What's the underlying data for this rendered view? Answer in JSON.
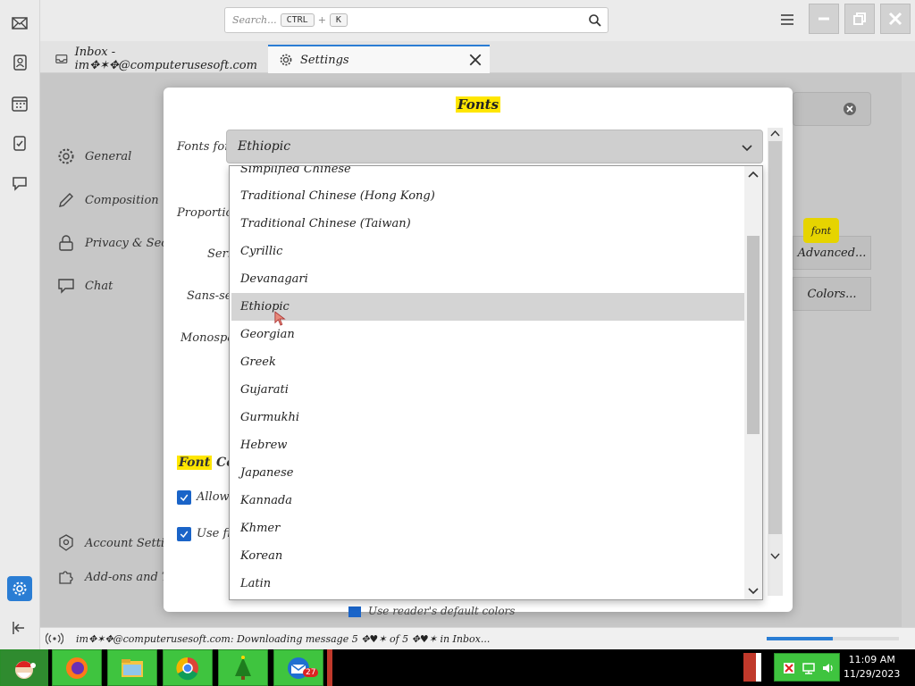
{
  "search": {
    "placeholder": "Search...",
    "shortcut_key1": "CTRL",
    "shortcut_sep": "+",
    "shortcut_key2": "K"
  },
  "tabs": [
    {
      "label": "Inbox - im✥✶✥@computerusesoft.com"
    },
    {
      "label": "Settings"
    }
  ],
  "settings_nav": [
    {
      "label": "General"
    },
    {
      "label": "Composition"
    },
    {
      "label": "Privacy & Secu"
    },
    {
      "label": "Chat"
    }
  ],
  "settings_bottom_nav": [
    {
      "label": "Account Settings"
    },
    {
      "label": "Add-ons and Themes"
    }
  ],
  "background_buttons": {
    "advanced": "Advanced...",
    "colors": "Colors...",
    "font_badge": "font"
  },
  "modal": {
    "title": "Fonts",
    "fonts_for_label": "Fonts for:",
    "selected_script": "Ethiopic",
    "labels": {
      "proportional": "Proportiona",
      "serif": "Seri",
      "sans_serif": "Sans-seri",
      "monospace": "Monospac"
    },
    "font_control_heading": "Font",
    "font_control_suffix": "Con",
    "checkbox_1": "Allow",
    "checkbox_2": "Use fi",
    "behind_text": "Use reader's default colors"
  },
  "dropdown_options": [
    "Simplified Chinese",
    "Traditional Chinese (Hong Kong)",
    "Traditional Chinese (Taiwan)",
    "Cyrillic",
    "Devanagari",
    "Ethiopic",
    "Georgian",
    "Greek",
    "Gujarati",
    "Gurmukhi",
    "Hebrew",
    "Japanese",
    "Kannada",
    "Khmer",
    "Korean",
    "Latin"
  ],
  "status": {
    "message": "im✥✶✥@computerusesoft.com: Downloading message 5 ✥♥✶ of 5 ✥♥✶ in Inbox...",
    "progress": 0.5
  },
  "taskbar": {
    "time": "11:09 AM",
    "date": "11/29/2023",
    "badge": "27"
  },
  "colors": {
    "accent": "#2a7dd4",
    "highlight": "#ffe600",
    "taskbar_app": "#3fc43f"
  }
}
